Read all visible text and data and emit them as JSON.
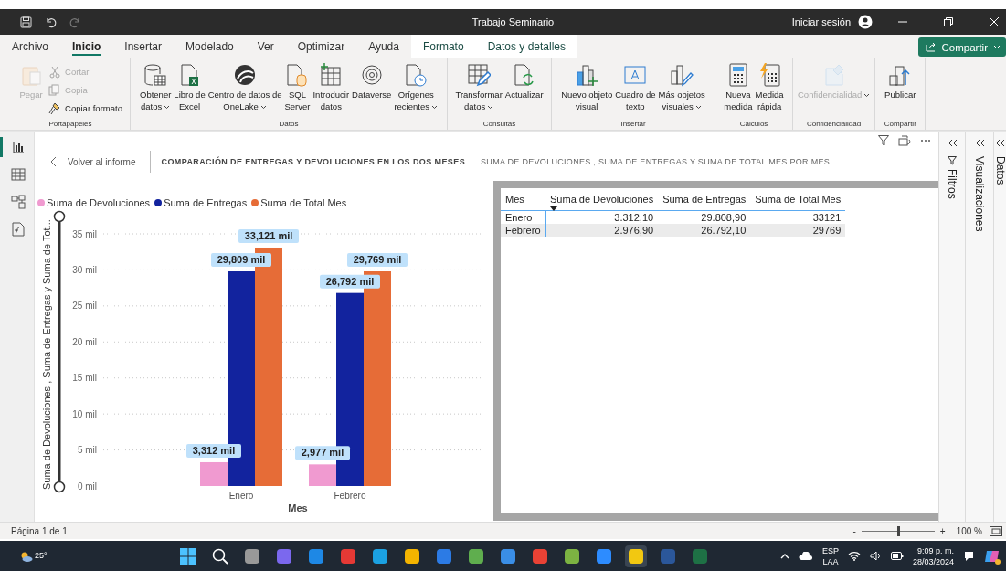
{
  "window": {
    "title": "Trabajo Seminario",
    "sign_in": "Iniciar sesión"
  },
  "tabs": [
    {
      "label": "Archivo",
      "selected": false,
      "kind": "standard"
    },
    {
      "label": "Inicio",
      "selected": true,
      "kind": "standard"
    },
    {
      "label": "Insertar",
      "selected": false,
      "kind": "standard"
    },
    {
      "label": "Modelado",
      "selected": false,
      "kind": "standard"
    },
    {
      "label": "Ver",
      "selected": false,
      "kind": "standard"
    },
    {
      "label": "Optimizar",
      "selected": false,
      "kind": "standard"
    },
    {
      "label": "Ayuda",
      "selected": false,
      "kind": "standard"
    },
    {
      "label": "Formato",
      "selected": false,
      "kind": "contextual"
    },
    {
      "label": "Datos y detalles",
      "selected": false,
      "kind": "contextual"
    }
  ],
  "share_button": {
    "label": "Compartir"
  },
  "ribbon": [
    {
      "group": "Portapapeles",
      "items": [
        {
          "label": "Pegar",
          "kind": "large",
          "disabled": true,
          "dropdown": false
        },
        {
          "label": "Cortar",
          "kind": "small",
          "disabled": true,
          "dropdown": false
        },
        {
          "label": "Copia",
          "kind": "small",
          "disabled": true,
          "dropdown": false
        },
        {
          "label": "Copiar formato",
          "kind": "small",
          "disabled": false,
          "dropdown": false
        }
      ]
    },
    {
      "group": "Datos",
      "items": [
        {
          "label": "Obtener\ndatos",
          "kind": "large",
          "disabled": false,
          "dropdown": true
        },
        {
          "label": "Libro de\nExcel",
          "kind": "large",
          "disabled": false,
          "dropdown": false
        },
        {
          "label": "Centro de datos de\nOneLake",
          "kind": "large",
          "disabled": false,
          "dropdown": true
        },
        {
          "label": "SQL\nServer",
          "kind": "large",
          "disabled": false,
          "dropdown": false
        },
        {
          "label": "Introducir\ndatos",
          "kind": "large",
          "disabled": false,
          "dropdown": false
        },
        {
          "label": "Dataverse",
          "kind": "large",
          "disabled": false,
          "dropdown": false
        },
        {
          "label": "Orígenes\nrecientes",
          "kind": "large",
          "disabled": false,
          "dropdown": true
        }
      ]
    },
    {
      "group": "Consultas",
      "items": [
        {
          "label": "Transformar\ndatos",
          "kind": "large",
          "disabled": false,
          "dropdown": true
        },
        {
          "label": "Actualizar",
          "kind": "large",
          "disabled": false,
          "dropdown": false
        }
      ]
    },
    {
      "group": "Insertar",
      "items": [
        {
          "label": "Nuevo objeto\nvisual",
          "kind": "large",
          "disabled": false,
          "dropdown": false
        },
        {
          "label": "Cuadro de\ntexto",
          "kind": "large",
          "disabled": false,
          "dropdown": false
        },
        {
          "label": "Más objetos\nvisuales",
          "kind": "large",
          "disabled": false,
          "dropdown": true
        }
      ]
    },
    {
      "group": "Cálculos",
      "items": [
        {
          "label": "Nueva\nmedida",
          "kind": "large",
          "disabled": false,
          "dropdown": false
        },
        {
          "label": "Medida\nrápida",
          "kind": "large",
          "disabled": false,
          "dropdown": false
        }
      ]
    },
    {
      "group": "Confidencialidad",
      "items": [
        {
          "label": "Confidencialidad",
          "kind": "large",
          "disabled": true,
          "dropdown": true
        }
      ]
    },
    {
      "group": "Compartir",
      "items": [
        {
          "label": "Publicar",
          "kind": "large",
          "disabled": false,
          "dropdown": false
        }
      ]
    }
  ],
  "left_nav": [
    {
      "selected": true
    },
    {
      "selected": false
    },
    {
      "selected": false
    },
    {
      "selected": false
    }
  ],
  "report": {
    "back": "Volver al informe",
    "title": "COMPARACIÓN DE ENTREGAS Y DEVOLUCIONES EN LOS DOS MESES",
    "subtitle": "SUMA DE DEVOLUCIONES , SUMA DE ENTREGAS Y SUMA DE TOTAL MES POR MES",
    "chart": {
      "chart_data": {
        "type": "bar",
        "xlabel": "Mes",
        "ylabel": "Suma de Devoluciones , Suma de Entregas y Suma de Tot...",
        "categories": [
          "Enero",
          "Febrero"
        ],
        "series": [
          {
            "name": "Suma de Devoluciones",
            "color": "#f09ad0",
            "values": [
              3.3,
              3.0
            ]
          },
          {
            "name": "Suma de Entregas",
            "color": "#12239e",
            "values": [
              29.8,
              26.8
            ]
          },
          {
            "name": "Suma de Total Mes",
            "color": "#e66c37",
            "values": [
              33.1,
              29.8
            ]
          }
        ],
        "ylim": [
          0,
          35
        ],
        "grid": true,
        "yticks": [
          {
            "value": 0,
            "label": "0 mil"
          },
          {
            "value": 5,
            "label": "5 mil"
          },
          {
            "value": 10,
            "label": "10 mil"
          },
          {
            "value": 15,
            "label": "15 mil"
          },
          {
            "value": 20,
            "label": "20 mil"
          },
          {
            "value": 25,
            "label": "25 mil"
          },
          {
            "value": 30,
            "label": "30 mil"
          },
          {
            "value": 35,
            "label": "35 mil"
          }
        ],
        "value_labels": [
          [
            "3,312 mil",
            "2,977 mil"
          ],
          [
            "29,809 mil",
            "26,792 mil"
          ],
          [
            "33,121 mil",
            "29,769 mil"
          ]
        ]
      }
    },
    "table": {
      "columns": [
        {
          "label": "Mes",
          "sorted": false
        },
        {
          "label": "Suma de Devoluciones",
          "sorted": true
        },
        {
          "label": "Suma de Entregas",
          "sorted": false
        },
        {
          "label": "Suma de Total Mes",
          "sorted": false
        }
      ],
      "rows": [
        [
          "Enero",
          "3.312,10",
          "29.808,90",
          "33121"
        ],
        [
          "Febrero",
          "2.976,90",
          "26.792,10",
          "29769"
        ]
      ]
    }
  },
  "panes": [
    {
      "label": "Filtros",
      "kind": "filter"
    },
    {
      "label": "Visualizaciones",
      "kind": "plain"
    },
    {
      "label": "Datos",
      "kind": "plain"
    }
  ],
  "status_bar": {
    "page": "Página 1 de 1",
    "zoom": {
      "minus": "-",
      "plus": "+",
      "level": 0.5,
      "reading": "100 %"
    }
  },
  "taskbar": {
    "weather": "25°",
    "apps": [
      {
        "active": false
      },
      {
        "active": false
      },
      {
        "active": false
      },
      {
        "active": false
      },
      {
        "active": false
      },
      {
        "active": false
      },
      {
        "active": false
      },
      {
        "active": false
      },
      {
        "active": false
      },
      {
        "active": false
      },
      {
        "active": false
      },
      {
        "active": false
      },
      {
        "active": false
      },
      {
        "active": false
      },
      {
        "active": true
      },
      {
        "active": false
      },
      {
        "active": false
      }
    ],
    "language": [
      "ESP",
      "LAA"
    ],
    "time": "9:09 p. m.",
    "date": "28/03/2024"
  }
}
